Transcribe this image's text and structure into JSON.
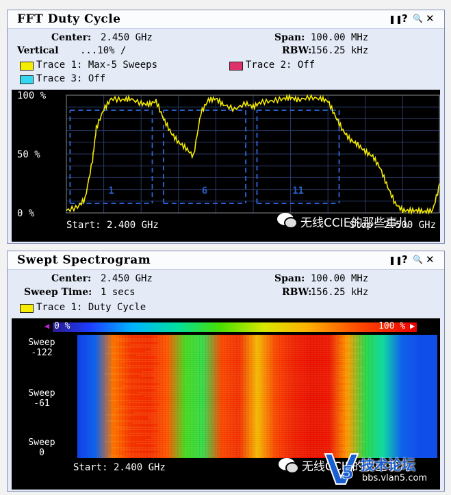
{
  "fft": {
    "title": "FFT Duty Cycle",
    "controls": {
      "pause": "❚❚",
      "help": "?",
      "zoom": "🔍",
      "close": "✕"
    },
    "center_label": "Center:",
    "center_value": "2.450 GHz",
    "span_label": "Span:",
    "span_value": "100.00 MHz",
    "vertical_label": "Vertical",
    "vertical_value": "...10% /",
    "rbw_label": "RBW:",
    "rbw_value": "156.25 kHz",
    "traces": [
      {
        "label": "Trace 1: Max-5 Sweeps",
        "color": "#f5ec00"
      },
      {
        "label": "Trace 2: Off",
        "color": "#e0306a"
      },
      {
        "label": "Trace 3: Off",
        "color": "#33d7f0"
      }
    ],
    "y_ticks": [
      "100 %",
      "50 %",
      "0 %"
    ],
    "channels": [
      "1",
      "6",
      "11"
    ],
    "start_label": "Start: 2.400 GHz",
    "stop_label": "Stop: 2.500 GHz"
  },
  "spectrogram": {
    "title": "Swept Spectrogram",
    "controls": {
      "pause": "❚❚",
      "help": "?",
      "zoom": "🔍",
      "close": "✕"
    },
    "center_label": "Center:",
    "center_value": "2.450 GHz",
    "span_label": "Span:",
    "span_value": "100.00 MHz",
    "sweep_time_label": "Sweep Time:",
    "sweep_time_value": "1 secs",
    "rbw_label": "RBW:",
    "rbw_value": "156.25 kHz",
    "trace": {
      "label": "Trace 1: Duty Cycle",
      "color": "#f5ec00"
    },
    "scale_min": "0 %",
    "scale_max": "100 %",
    "sweep_labels": [
      {
        "title": "Sweep",
        "value": "-122"
      },
      {
        "title": "Sweep",
        "value": "-61"
      },
      {
        "title": "Sweep",
        "value": "0"
      }
    ],
    "start_label": "Start: 2.400 GHz"
  },
  "watermarks": {
    "wechat": "无线CCIE的那些事儿",
    "forum_name": "技术论坛",
    "forum_url": "bbs.vlan5.com"
  },
  "colors": {
    "trace_yellow": "#f5ec00",
    "channel_blue": "#2a5ec8",
    "grid": "#2b3a6a",
    "spectro_background": "#0a3ce0"
  },
  "chart_data": [
    {
      "type": "line",
      "title": "FFT Duty Cycle",
      "xlabel": "",
      "ylabel": "",
      "xlim": [
        2.4,
        2.5
      ],
      "ylim": [
        0,
        100
      ],
      "y_ticks": [
        "100 %",
        "50 %",
        "0 %"
      ],
      "grid": true,
      "series": [
        {
          "name": "Trace 1: Max-5 Sweeps",
          "x": [
            2.4,
            2.403,
            2.405,
            2.407,
            2.408,
            2.41,
            2.412,
            2.415,
            2.417,
            2.42,
            2.422,
            2.424,
            2.426,
            2.428,
            2.43,
            2.432,
            2.434,
            2.436,
            2.438,
            2.44,
            2.442,
            2.445,
            2.448,
            2.45,
            2.452,
            2.455,
            2.458,
            2.46,
            2.462,
            2.465,
            2.468,
            2.47,
            2.472,
            2.474,
            2.476,
            2.478,
            2.48,
            2.482,
            2.484,
            2.486,
            2.488,
            2.49,
            2.492,
            2.494,
            2.496,
            2.498,
            2.5
          ],
          "y": [
            2,
            5,
            12,
            45,
            72,
            88,
            97,
            96,
            97,
            93,
            92,
            95,
            80,
            68,
            60,
            55,
            48,
            85,
            96,
            97,
            92,
            88,
            93,
            90,
            94,
            95,
            97,
            98,
            96,
            98,
            97,
            95,
            82,
            70,
            62,
            58,
            52,
            48,
            38,
            22,
            8,
            2,
            2,
            2,
            1,
            2,
            25
          ]
        }
      ]
    },
    {
      "type": "heatmap",
      "title": "Swept Spectrogram",
      "xlabel": "",
      "ylabel": "",
      "xlim": [
        2.4,
        2.5
      ],
      "y_ticks": [
        "-122",
        "-61",
        "0"
      ],
      "scale": [
        "0 %",
        "100 %"
      ],
      "x": [
        2.4,
        2.405,
        2.41,
        2.415,
        2.42,
        2.425,
        2.43,
        2.435,
        2.44,
        2.445,
        2.45,
        2.455,
        2.46,
        2.465,
        2.47,
        2.475,
        2.48,
        2.485,
        2.49,
        2.495,
        2.5
      ],
      "values": [
        0,
        5,
        80,
        90,
        92,
        85,
        45,
        40,
        88,
        92,
        70,
        88,
        95,
        98,
        97,
        75,
        40,
        30,
        5,
        2,
        2
      ]
    }
  ]
}
